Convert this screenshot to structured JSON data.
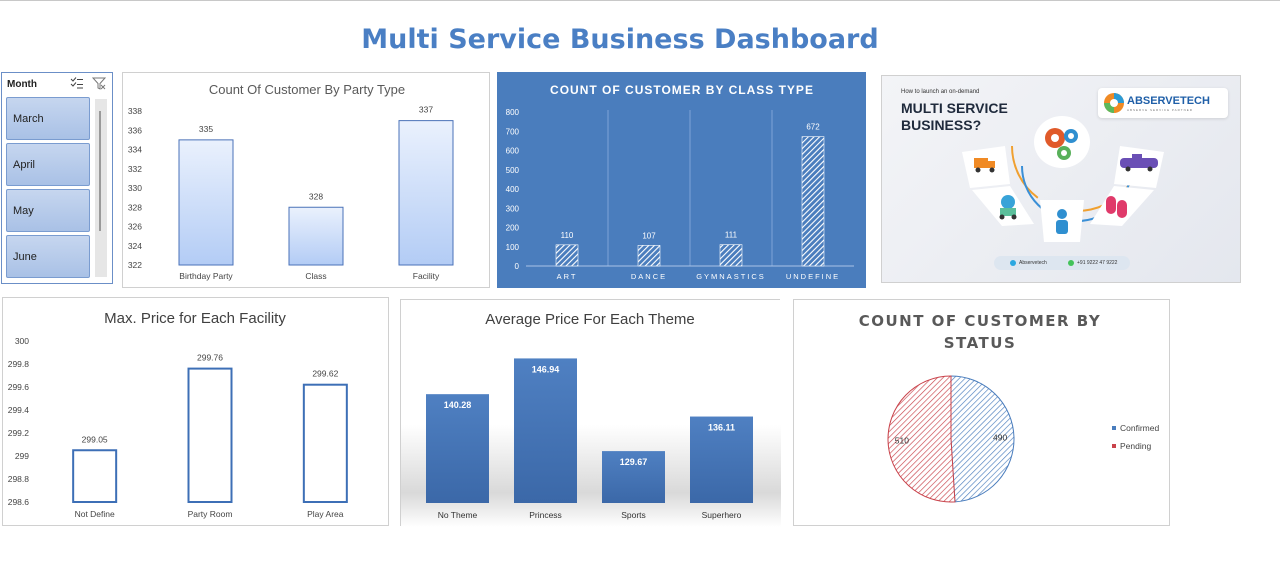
{
  "dashboard_title": "Multi Service Business Dashboard",
  "slicer": {
    "header": "Month",
    "items": [
      "March",
      "April",
      "May",
      "June"
    ],
    "icons": [
      "multi-select-icon",
      "clear-filter-icon"
    ]
  },
  "promo": {
    "small_text": "How to launch an on-demand",
    "big_line1": "MULTI SERVICE",
    "big_line2": "BUSINESS?",
    "brand": "ABSERVETECH",
    "brand_sub": "ABSERVE SERVICE PARTNER",
    "footer_skype": "Abservetech",
    "footer_phone": "+91 9222 47 9222",
    "icons": [
      "gears-icon",
      "ambulance-icon",
      "taxi-icon",
      "delivery-icon",
      "baby-icon",
      "pills-icon"
    ]
  },
  "colors": {
    "title": "#4a7fc4",
    "blue": "#4a7dbd",
    "pending": "#c9434b",
    "bar_fill_light": "#dbe7fa"
  },
  "chart_data": [
    {
      "id": "party",
      "type": "bar",
      "title": "Count Of Customer By Party Type",
      "categories": [
        "Birthday Party",
        "Class",
        "Facility"
      ],
      "values": [
        335,
        328,
        337
      ],
      "ylim": [
        322,
        338
      ],
      "yticks": [
        322,
        324,
        326,
        328,
        330,
        332,
        334,
        336,
        338
      ],
      "data_labels": true,
      "grid": false,
      "legend": "none"
    },
    {
      "id": "class",
      "type": "bar",
      "title": "COUNT OF CUSTOMER BY CLASS TYPE",
      "categories": [
        "ART",
        "DANCE",
        "GYMNASTICS",
        "UNDEFINE"
      ],
      "values": [
        110,
        107,
        111,
        672
      ],
      "ylim": [
        0,
        800
      ],
      "yticks": [
        0,
        100,
        200,
        300,
        400,
        500,
        600,
        700,
        800
      ],
      "data_labels": true,
      "grid": false,
      "legend": "none"
    },
    {
      "id": "facility",
      "type": "bar",
      "title": "Max. Price for Each Facility",
      "categories": [
        "Not Define",
        "Party Room",
        "Play Area"
      ],
      "values": [
        299.05,
        299.76,
        299.62
      ],
      "ylim": [
        298.6,
        300
      ],
      "yticks": [
        "298.6",
        "298.8",
        "299",
        "299.2",
        "299.4",
        "299.6",
        "299.8",
        "300"
      ],
      "data_labels": true,
      "grid": false,
      "legend": "none"
    },
    {
      "id": "theme",
      "type": "bar",
      "title": "Average Price For Each Theme",
      "categories": [
        "No Theme",
        "Princess",
        "Sports",
        "Superhero"
      ],
      "values": [
        140.28,
        146.94,
        129.67,
        136.11
      ],
      "data_labels": true,
      "grid": false,
      "legend": "none"
    },
    {
      "id": "status",
      "type": "pie",
      "title_line1": "COUNT OF CUSTOMER BY",
      "title_line2": "STATUS",
      "series": [
        {
          "name": "Confirmed",
          "value": 490
        },
        {
          "name": "Pending",
          "value": 510
        }
      ],
      "data_labels": true,
      "legend": "right"
    }
  ]
}
